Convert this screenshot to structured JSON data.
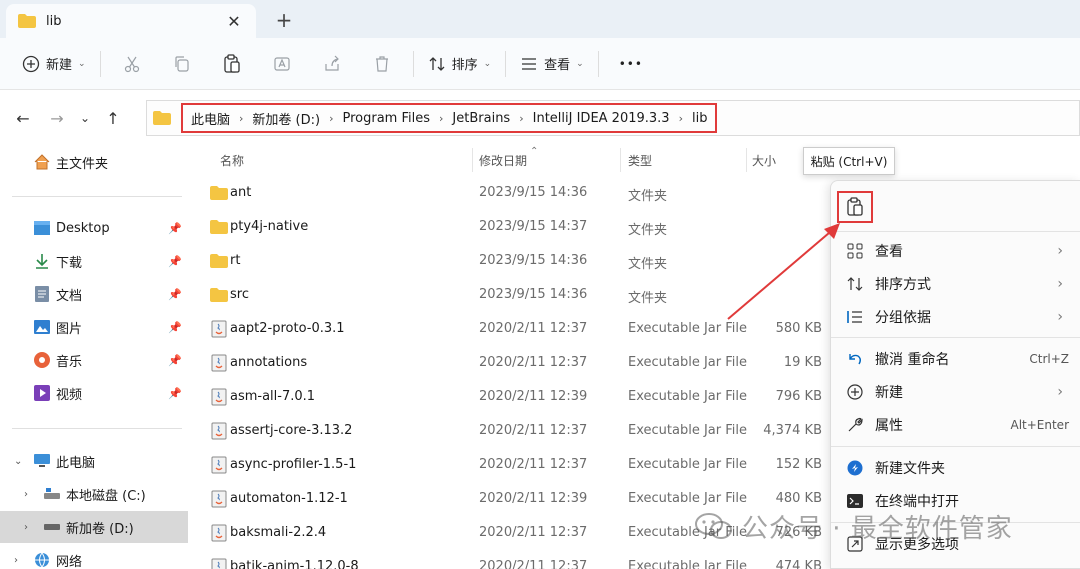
{
  "tab": {
    "title": "lib",
    "close": "✕",
    "new_tab": "+"
  },
  "toolbar": {
    "new_label": "新建",
    "sort_label": "排序",
    "view_label": "查看",
    "more": "•••"
  },
  "breadcrumbs": [
    "此电脑",
    "新加卷 (D:)",
    "Program Files",
    "JetBrains",
    "IntelliJ IDEA 2019.3.3",
    "lib"
  ],
  "sidebar": {
    "home": "主文件夹",
    "quick": [
      {
        "label": "Desktop",
        "icon": "desktop-icon"
      },
      {
        "label": "下载",
        "icon": "download-icon"
      },
      {
        "label": "文档",
        "icon": "document-icon"
      },
      {
        "label": "图片",
        "icon": "picture-icon"
      },
      {
        "label": "音乐",
        "icon": "music-icon"
      },
      {
        "label": "视频",
        "icon": "video-icon"
      }
    ],
    "this_pc": "此电脑",
    "drives": [
      "本地磁盘 (C:)",
      "新加卷 (D:)"
    ],
    "network": "网络"
  },
  "columns": {
    "name": "名称",
    "date": "修改日期",
    "type": "类型",
    "size": "大小"
  },
  "files": [
    {
      "name": "ant",
      "date": "2023/9/15 14:36",
      "type": "文件夹",
      "size": "",
      "kind": "folder"
    },
    {
      "name": "pty4j-native",
      "date": "2023/9/15 14:37",
      "type": "文件夹",
      "size": "",
      "kind": "folder"
    },
    {
      "name": "rt",
      "date": "2023/9/15 14:36",
      "type": "文件夹",
      "size": "",
      "kind": "folder"
    },
    {
      "name": "src",
      "date": "2023/9/15 14:36",
      "type": "文件夹",
      "size": "",
      "kind": "folder"
    },
    {
      "name": "aapt2-proto-0.3.1",
      "date": "2020/2/11 12:37",
      "type": "Executable Jar File",
      "size": "580 KB",
      "kind": "jar"
    },
    {
      "name": "annotations",
      "date": "2020/2/11 12:37",
      "type": "Executable Jar File",
      "size": "19 KB",
      "kind": "jar"
    },
    {
      "name": "asm-all-7.0.1",
      "date": "2020/2/11 12:39",
      "type": "Executable Jar File",
      "size": "796 KB",
      "kind": "jar"
    },
    {
      "name": "assertj-core-3.13.2",
      "date": "2020/2/11 12:37",
      "type": "Executable Jar File",
      "size": "4,374 KB",
      "kind": "jar"
    },
    {
      "name": "async-profiler-1.5-1",
      "date": "2020/2/11 12:37",
      "type": "Executable Jar File",
      "size": "152 KB",
      "kind": "jar"
    },
    {
      "name": "automaton-1.12-1",
      "date": "2020/2/11 12:39",
      "type": "Executable Jar File",
      "size": "480 KB",
      "kind": "jar"
    },
    {
      "name": "baksmali-2.2.4",
      "date": "2020/2/11 12:37",
      "type": "Executable Jar File",
      "size": "726 KB",
      "kind": "jar"
    },
    {
      "name": "batik-anim-1.12.0-8",
      "date": "2020/2/11 12:37",
      "type": "Executable Jar File",
      "size": "474 KB",
      "kind": "jar"
    }
  ],
  "tooltip": "粘贴 (Ctrl+V)",
  "context_menu": {
    "view": "查看",
    "sort": "排序方式",
    "group": "分组依据",
    "undo": "撤消 重命名",
    "undo_shortcut": "Ctrl+Z",
    "new": "新建",
    "properties": "属性",
    "properties_shortcut": "Alt+Enter",
    "new_folder": "新建文件夹",
    "open_terminal": "在终端中打开",
    "more_options": "显示更多选项"
  },
  "watermark": "公众号 · 最全软件管家",
  "colors": {
    "accent": "#0067c0",
    "highlight": "#e03a3a",
    "folder": "#f4c542"
  }
}
